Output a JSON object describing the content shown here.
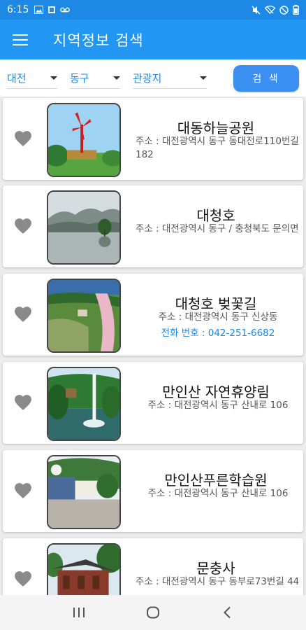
{
  "status_bar": {
    "time": "6:15",
    "left_icons": [
      "image-icon",
      "box-icon",
      "voicemail-icon"
    ],
    "right_icons": [
      "mute-icon",
      "wifi-icon",
      "do-not-disturb-icon",
      "battery-icon"
    ]
  },
  "app_bar": {
    "menu_icon": "hamburger-menu-icon",
    "title": "지역정보 검색"
  },
  "filters": {
    "city": "대전",
    "district": "동구",
    "category": "관광지",
    "search_label": "검 색"
  },
  "places": [
    {
      "name": "대동하늘공원",
      "address": "주소 : 대전광역시 동구 동대전로110번길 182",
      "phone": ""
    },
    {
      "name": "대청호",
      "address": "주소 : 대전광역시 동구 / 충청북도 문의면",
      "phone": ""
    },
    {
      "name": "대청호 벚꽃길",
      "address": "주소 : 대전광역시 동구 신상동",
      "phone": "전화 번호 : 042-251-6682"
    },
    {
      "name": "만인산 자연휴양림",
      "address": "주소 : 대전광역시 동구 산내로 106",
      "phone": ""
    },
    {
      "name": "만인산푸른학습원",
      "address": "주소 : 대전광역시 동구 산내로 106",
      "phone": ""
    },
    {
      "name": "문충사",
      "address": "주소 : 대전광역시 동구 동부로73번길 44",
      "phone": ""
    }
  ],
  "nav_bar": {
    "icons": [
      "recent-apps-icon",
      "home-icon",
      "back-icon"
    ]
  },
  "colors": {
    "status_bar": "#1e88e5",
    "app_bar": "#2196f3",
    "accent": "#1e88e5",
    "search_button": "#3b8ff0",
    "heart": "#8a8a8a"
  }
}
